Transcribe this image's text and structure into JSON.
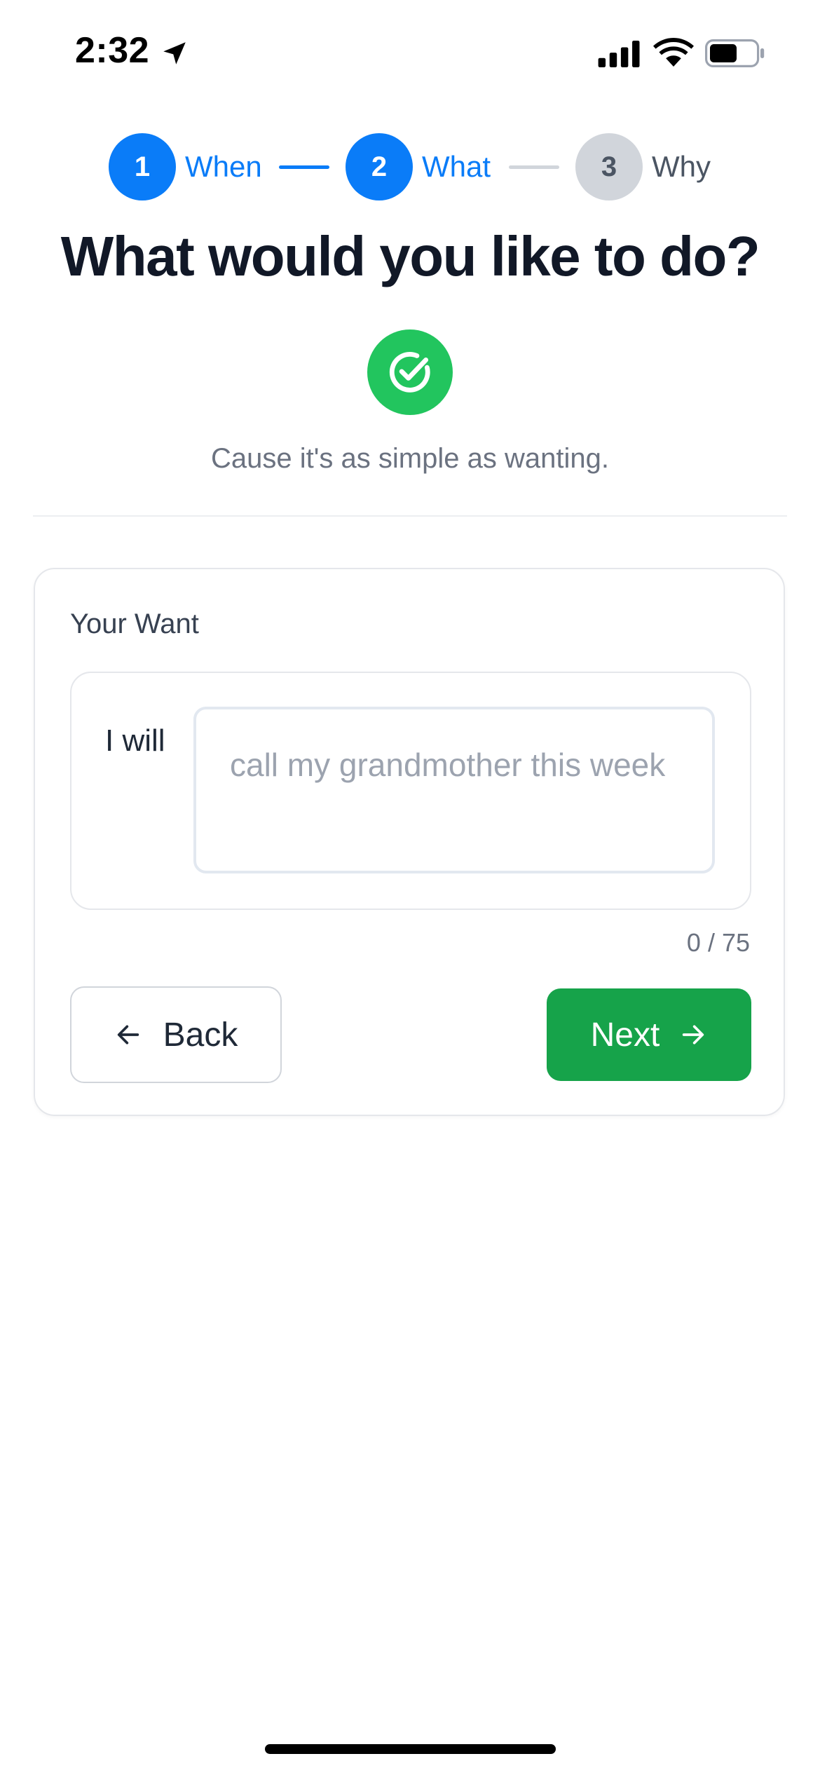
{
  "status_bar": {
    "time": "2:32",
    "icons": [
      "location-arrow-icon",
      "cellular-signal-icon",
      "wifi-icon",
      "battery-icon"
    ]
  },
  "stepper": {
    "steps": [
      {
        "number": "1",
        "label": "When",
        "state": "active"
      },
      {
        "number": "2",
        "label": "What",
        "state": "active"
      },
      {
        "number": "3",
        "label": "Why",
        "state": "inactive"
      }
    ]
  },
  "header": {
    "title": "What would you like to do?",
    "icon": "check-circle-icon",
    "subtitle": "Cause it's as simple as wanting."
  },
  "form": {
    "label": "Your Want",
    "prefix": "I will",
    "input_value": "",
    "input_placeholder": "call my grandmother this week",
    "char_counter": "0 / 75",
    "back_label": "Back",
    "next_label": "Next"
  },
  "colors": {
    "accent_blue": "#0a7cf8",
    "success_green": "#22c55e",
    "button_green": "#16a34a",
    "inactive_gray": "#d1d5db"
  }
}
